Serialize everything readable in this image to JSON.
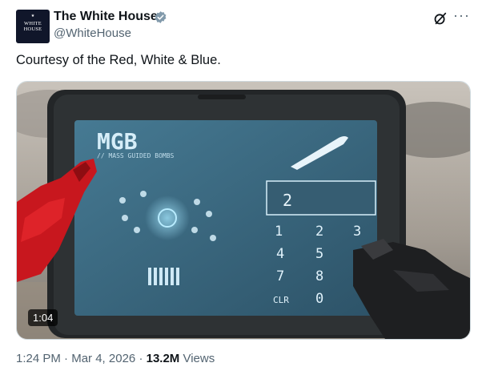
{
  "author": {
    "name": "The White House",
    "handle": "@WhiteHouse",
    "avatar_text": [
      "WHITE",
      "HOUSE"
    ]
  },
  "tweet": {
    "text": "Courtesy of the Red, White & Blue."
  },
  "video": {
    "duration": "1:04",
    "screen_title": "MGB",
    "screen_subtitle": "// MASS GUIDED BOMBS",
    "entry_value": "2",
    "keypad": [
      "1",
      "2",
      "3",
      "4",
      "5",
      "7",
      "8",
      "CLR",
      "0"
    ]
  },
  "meta": {
    "time": "1:24 PM",
    "sep1": "·",
    "date": "Mar 4, 2026",
    "sep2": "·",
    "views_count": "13.2M",
    "views_label": "Views"
  },
  "colors": {
    "verified": "#829aab",
    "muted": "#536471",
    "screen_bg": "#3d6a82",
    "screen_text": "#d6eef9",
    "glove_red": "#c8171e"
  },
  "icons": {
    "verified": "verified-badge-icon",
    "grok": "grok-icon",
    "more": "more-icon"
  }
}
